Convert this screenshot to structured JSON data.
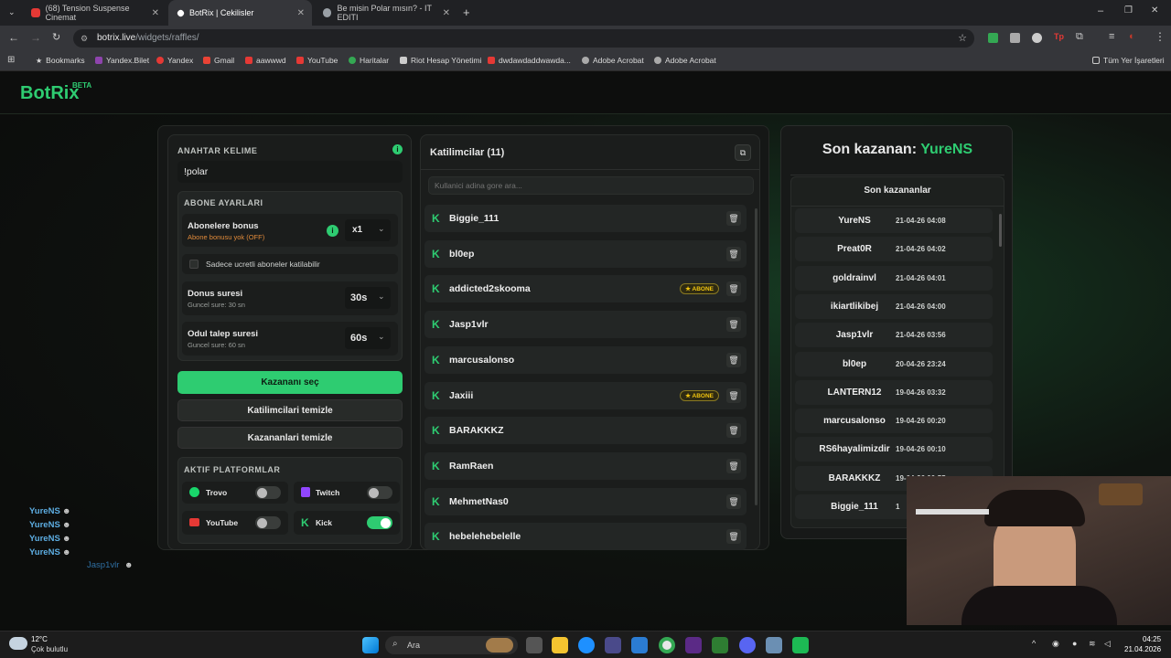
{
  "browser": {
    "tabs": [
      {
        "label": "(68) Tension Suspense Cinemat",
        "color": "#e53935"
      },
      {
        "label": "BotRix | Cekilisler",
        "color": "#ffffff"
      },
      {
        "label": "Be misin Polar mısın? - IT EDITI",
        "color": "#9aa0a6"
      }
    ],
    "url_host": "botrix.live",
    "url_path": "/widgets/raffles/",
    "bookmarks": [
      "Bookmarks",
      "Yandex.Bilet",
      "Yandex",
      "Gmail",
      "aawwwd",
      "YouTube",
      "Haritalar",
      "Riot Hesap Yönetimi",
      "dwdawdaddwawda...",
      "Adobe Acrobat",
      "Adobe Acrobat"
    ],
    "all_bookmarks": "Tüm Yer İşaretleri"
  },
  "logo": {
    "text": "BotRix",
    "beta": "BETA"
  },
  "settings": {
    "keyword_label": "ANAHTAR KELIME",
    "keyword_value": "!polar",
    "sub_settings_label": "ABONE AYARLARI",
    "sub_bonus_title": "Abonelere bonus",
    "sub_bonus_sub": "Abone bonusu yok (OFF)",
    "sub_bonus_value": "x1",
    "paid_only_label": "Sadece ucretli aboneler katilabilir",
    "duration_title": "Donus suresi",
    "duration_sub": "Guncel sure: 30 sn",
    "duration_value": "30s",
    "claim_title": "Odul talep suresi",
    "claim_sub": "Guncel sure: 60 sn",
    "claim_value": "60s",
    "pick_winner": "Kazananı seç",
    "clear_participants": "Katilimcilari temizle",
    "clear_winners": "Kazananlari temizle",
    "platforms_label": "AKTIF PLATFORMLAR",
    "platforms": [
      {
        "name": "Trovo",
        "on": false
      },
      {
        "name": "Twitch",
        "on": false
      },
      {
        "name": "YouTube",
        "on": false
      },
      {
        "name": "Kick",
        "on": true
      }
    ]
  },
  "participants": {
    "title": "Katilimcilar (11)",
    "search_placeholder": "Kullanici adina gore ara...",
    "badge_label": "ABONE",
    "items": [
      {
        "name": "Biggie_111",
        "sub": false
      },
      {
        "name": "bl0ep",
        "sub": false
      },
      {
        "name": "addicted2skooma",
        "sub": true
      },
      {
        "name": "Jasp1vlr",
        "sub": false
      },
      {
        "name": "marcusalonso",
        "sub": false
      },
      {
        "name": "Jaxiii",
        "sub": true
      },
      {
        "name": "BARAKKKZ",
        "sub": false
      },
      {
        "name": "RamRaen",
        "sub": false
      },
      {
        "name": "MehmetNas0",
        "sub": false
      },
      {
        "name": "hebelehebelelle",
        "sub": false
      }
    ]
  },
  "winners": {
    "last_winner_prefix": "Son kazanan:",
    "last_winner_name": "YureNS",
    "list_title": "Son kazananlar",
    "items": [
      {
        "name": "YureNS",
        "date": "21-04-26 04:08"
      },
      {
        "name": "Preat0R",
        "date": "21-04-26 04:02"
      },
      {
        "name": "goldrainvl",
        "date": "21-04-26 04:01"
      },
      {
        "name": "ikiartlikibej",
        "date": "21-04-26 04:00"
      },
      {
        "name": "Jasp1vlr",
        "date": "21-04-26 03:56"
      },
      {
        "name": "bl0ep",
        "date": "20-04-26 23:24"
      },
      {
        "name": "LANTERN12",
        "date": "19-04-26 03:32"
      },
      {
        "name": "marcusalonso",
        "date": "19-04-26 00:20"
      },
      {
        "name": "RS6hayalimizdir",
        "date": "19-04-26 00:10"
      },
      {
        "name": "BARAKKKZ",
        "date": "19-04-26 00:55"
      },
      {
        "name": "Biggie_111",
        "date": "1"
      }
    ]
  },
  "chat": [
    "YureNS",
    "YureNS",
    "YureNS",
    "YureNS",
    "Jasp1vlr"
  ],
  "taskbar": {
    "weather_temp": "12°C",
    "weather_desc": "Çok bulutlu",
    "search": "Ara",
    "time": "04:25",
    "date": "21.04.2026"
  },
  "colors": {
    "accent": "#2ecc71",
    "badge": "#f1c40f"
  }
}
